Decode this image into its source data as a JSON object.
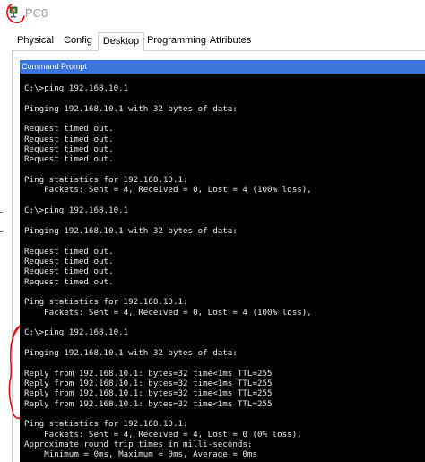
{
  "window": {
    "title": "PC0",
    "icon": "pc-device-icon"
  },
  "tabs": [
    {
      "label": "Physical",
      "active": false
    },
    {
      "label": "Config",
      "active": false
    },
    {
      "label": "Desktop",
      "active": true
    },
    {
      "label": "Programming",
      "active": false
    },
    {
      "label": "Attributes",
      "active": false
    }
  ],
  "command_prompt": {
    "header": "Command Prompt",
    "lines": [
      "C:\\>ping 192.168.10.1",
      "",
      "Pinging 192.168.10.1 with 32 bytes of data:",
      "",
      "Request timed out.",
      "Request timed out.",
      "Request timed out.",
      "Request timed out.",
      "",
      "Ping statistics for 192.168.10.1:",
      "    Packets: Sent = 4, Received = 0, Lost = 4 (100% loss),",
      "",
      "C:\\>ping 192.168.10.1",
      "",
      "Pinging 192.168.10.1 with 32 bytes of data:",
      "",
      "Request timed out.",
      "Request timed out.",
      "Request timed out.",
      "Request timed out.",
      "",
      "Ping statistics for 192.168.10.1:",
      "    Packets: Sent = 4, Received = 0, Lost = 4 (100% loss),",
      "",
      "C:\\>ping 192.168.10.1",
      "",
      "Pinging 192.168.10.1 with 32 bytes of data:",
      "",
      "Reply from 192.168.10.1: bytes=32 time<1ms TTL=255",
      "Reply from 192.168.10.1: bytes=32 time<1ms TTL=255",
      "Reply from 192.168.10.1: bytes=32 time<1ms TTL=255",
      "Reply from 192.168.10.1: bytes=32 time<1ms TTL=255",
      "",
      "Ping statistics for 192.168.10.1:",
      "    Packets: Sent = 4, Received = 4, Lost = 0 (0% loss),",
      "Approximate round trip times in milli-seconds:",
      "    Minimum = 0ms, Maximum = 0ms, Average = 0ms"
    ]
  },
  "colors": {
    "header_bar": "#3a73d9",
    "terminal_bg": "#000000",
    "terminal_text": "#e8e8e8",
    "annotation": "#e01010"
  }
}
